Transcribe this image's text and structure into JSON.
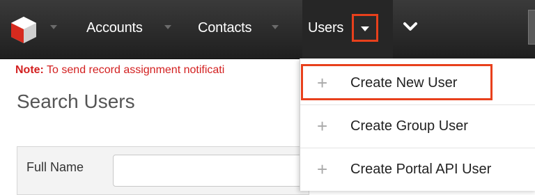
{
  "nav": {
    "tabs": [
      {
        "label": "Accounts"
      },
      {
        "label": "Contacts"
      },
      {
        "label": "Users"
      }
    ]
  },
  "notice": {
    "prefix": "Note:",
    "text": " To send record assignment notificati"
  },
  "page": {
    "title": "Search Users"
  },
  "search": {
    "full_name_label": "Full Name",
    "full_name_value": ""
  },
  "dropdown": {
    "items": [
      {
        "label": "Create New User",
        "icon": "plus-icon"
      },
      {
        "label": "Create Group User",
        "icon": "plus-icon"
      },
      {
        "label": "Create Portal API User",
        "icon": "plus-icon"
      }
    ]
  },
  "colors": {
    "navbar": "#2b2b2b",
    "highlight": "#e8401c",
    "notice": "#d32020",
    "logo_red": "#d62a1e"
  }
}
